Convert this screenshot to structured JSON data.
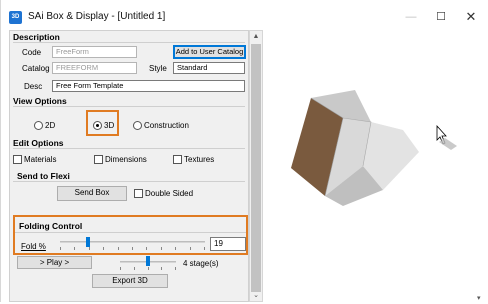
{
  "window": {
    "title": "SAi Box & Display - [Untitled 1]",
    "icon_text": "3D",
    "min_glyph": "—",
    "max_glyph": "☐",
    "close_glyph": "✕"
  },
  "description": {
    "heading": "Description",
    "code_label": "Code",
    "code_value": "FreeForm",
    "add_catalog_button": "Add to User Catalog",
    "catalog_label": "Catalog",
    "catalog_value": "FREEFORM",
    "style_label": "Style",
    "style_value": "Standard",
    "desc_label": "Desc",
    "desc_value": "Free Form Template"
  },
  "view_options": {
    "heading": "View Options",
    "options": [
      "2D",
      "3D",
      "Construction"
    ],
    "selected": "3D"
  },
  "edit_options": {
    "heading": "Edit Options",
    "checkboxes": [
      "Materials",
      "Dimensions",
      "Textures"
    ]
  },
  "send_to_flexi": {
    "heading": "Send to Flexi",
    "send_box_button": "Send Box",
    "double_sided_label": "Double Sided"
  },
  "folding_control": {
    "heading": "Folding Control",
    "fold_label": "Fold %",
    "fold_value": "19",
    "fold_fraction": 0.19,
    "play_button": "> Play >",
    "stage_label": "4 stage(s)",
    "stage_fraction": 0.5,
    "export_button": "Export 3D"
  },
  "scrollbar": {
    "up_glyph": "▲",
    "down_glyph": "⌄"
  },
  "colors": {
    "highlight": "#e07b22",
    "accent": "#0078d7",
    "box_inside": "#d9d9d9",
    "box_outside": "#7a5a3e"
  }
}
